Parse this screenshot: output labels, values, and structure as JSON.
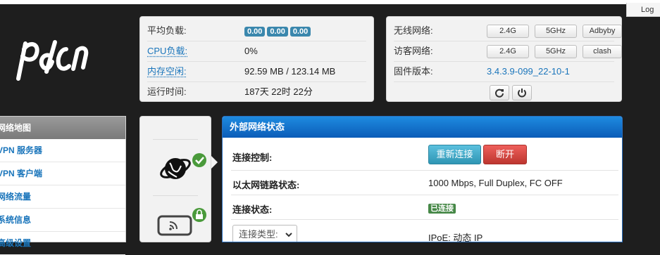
{
  "header": {
    "log_label": "Log"
  },
  "logo": {
    "text": "pdcn"
  },
  "info": {
    "load_label": "平均负载:",
    "load_values": [
      "0.00",
      "0.00",
      "0.00"
    ],
    "cpu_label": "CPU负载:",
    "cpu_value": "0%",
    "mem_label": "内存空闲:",
    "mem_value": "92.59 MB / 123.14 MB",
    "uptime_label": "运行时间:",
    "uptime_value": "187天 22时 22分"
  },
  "network": {
    "wireless_label": "无线网络:",
    "wireless_buttons": [
      "2.4G",
      "5GHz",
      "Adbyby"
    ],
    "guest_label": "访客网络:",
    "guest_buttons": [
      "2.4G",
      "5GHz",
      "clash"
    ],
    "firmware_label": "固件版本:",
    "firmware_value": "3.4.3.9-099_22-10-1"
  },
  "sidebar": {
    "header": "网络地图",
    "items": [
      "VPN 服务器",
      "VPN 客户端",
      "网络流量",
      "系统信息",
      "高级设置"
    ]
  },
  "main": {
    "title": "外部网络状态",
    "conn_control_label": "连接控制:",
    "reconnect_label": "重新连接",
    "disconnect_label": "断开",
    "link_label": "以太网链路状态:",
    "link_value": "1000 Mbps, Full Duplex, FC OFF",
    "status_label": "连接状态:",
    "status_value": "已连接",
    "conn_type_placeholder": "连接类型:",
    "conn_type_value": "IPoE: 动态 IP"
  },
  "colors": {
    "accent_blue": "#1a75bb",
    "header_blue": "#0b5cb8",
    "ok_green": "#468847",
    "danger_red": "#bd362f",
    "info_cyan": "#2f96b4"
  }
}
